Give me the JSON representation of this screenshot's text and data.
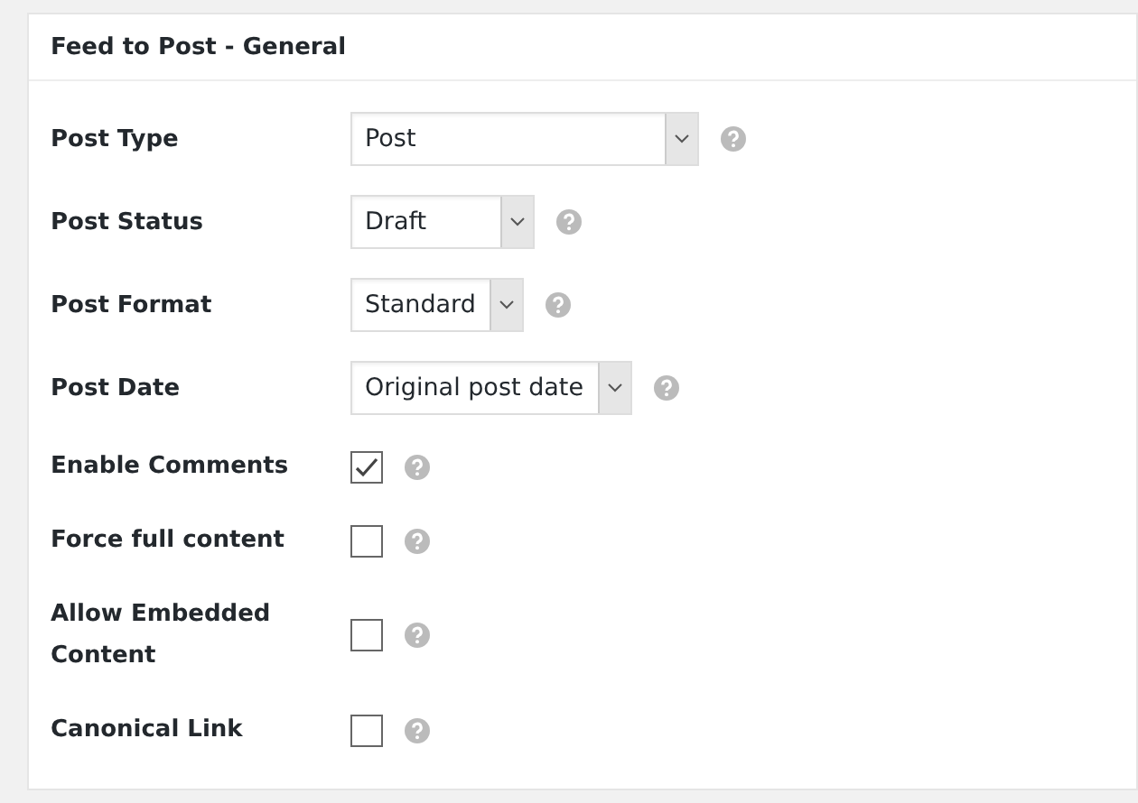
{
  "panel": {
    "title": "Feed to Post - General"
  },
  "rows": [
    {
      "kind": "select",
      "label": "Post Type",
      "value": "Post"
    },
    {
      "kind": "select",
      "label": "Post Status",
      "value": "Draft"
    },
    {
      "kind": "select",
      "label": "Post Format",
      "value": "Standard"
    },
    {
      "kind": "select",
      "label": "Post Date",
      "value": "Original post date"
    },
    {
      "kind": "checkbox",
      "label": "Enable Comments",
      "checked": true
    },
    {
      "kind": "checkbox",
      "label": "Force full content",
      "checked": false
    },
    {
      "kind": "checkbox",
      "label": "Allow Embedded Content",
      "checked": false
    },
    {
      "kind": "checkbox",
      "label": "Canonical Link",
      "checked": false
    }
  ]
}
